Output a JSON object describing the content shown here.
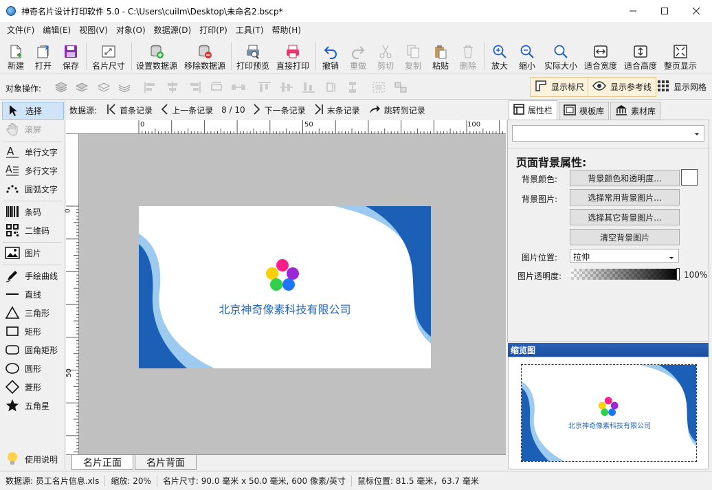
{
  "window": {
    "title": "神奇名片设计打印软件 5.0 - C:\\Users\\cuilm\\Desktop\\未命名2.bscp*"
  },
  "menu": [
    "文件(F)",
    "编辑(E)",
    "视图(V)",
    "对象(O)",
    "数据源(D)",
    "打印(P)",
    "工具(T)",
    "帮助(H)"
  ],
  "toolbar": {
    "new": "新建",
    "open": "打开",
    "save": "保存",
    "card_size": "名片尺寸",
    "set_datasource": "设置数据源",
    "remove_datasource": "移除数据源",
    "print_preview": "打印预览",
    "direct_print": "直接打印",
    "undo": "撤销",
    "redo": "重做",
    "cut": "剪切",
    "copy": "复制",
    "paste": "粘贴",
    "delete": "删除",
    "zoom_in": "放大",
    "zoom_out": "缩小",
    "actual_size": "实际大小",
    "fit_width": "适合宽度",
    "fit_height": "适合高度",
    "full_page": "整页显示"
  },
  "objbar": {
    "label": "对象操作:",
    "show_ruler": "显示标尺",
    "show_guides": "显示参考线",
    "show_grid": "显示网格"
  },
  "tools": {
    "select": "选择",
    "scroll": "滚屏",
    "single_text": "单行文字",
    "multi_text": "多行文字",
    "arc_text": "圆弧文字",
    "barcode": "条码",
    "qrcode": "二维码",
    "image": "图片",
    "freehand": "手绘曲线",
    "line": "直线",
    "triangle": "三角形",
    "rect": "矩形",
    "round_rect": "圆角矩形",
    "ellipse": "圆形",
    "diamond": "菱形",
    "star": "五角星",
    "help": "使用说明"
  },
  "nav": {
    "label": "数据源:",
    "first": "首条记录",
    "prev": "上一条记录",
    "counter": "8 / 10",
    "next": "下一条记录",
    "last": "末条记录",
    "jump": "跳转到记录"
  },
  "ruler": {
    "h_labels": [
      "0",
      "50",
      "100"
    ],
    "v_labels": [
      "0",
      "50"
    ]
  },
  "card": {
    "company": "北京神奇像素科技有限公司",
    "dot_colors": [
      "#ff1e8c",
      "#9c27d9",
      "#ffd000",
      "#2fd04a",
      "#1e74ff"
    ],
    "wave_dark": "#1b5fb7",
    "wave_light": "#9dcbf0"
  },
  "pages": {
    "front": "名片正面",
    "back": "名片背面"
  },
  "right_tabs": {
    "props": "属性栏",
    "templates": "模板库",
    "materials": "素材库"
  },
  "props": {
    "section_title": "页面背景属性:",
    "bg_color_label": "背景颜色:",
    "bg_color_btn": "背景颜色和透明度...",
    "bg_image_label": "背景图片:",
    "choose_common": "选择常用背景图片...",
    "choose_other": "选择其它背景图片...",
    "clear_bg": "清空背景图片",
    "image_pos_label": "图片位置:",
    "image_pos_value": "拉伸",
    "opacity_label": "图片透明度:",
    "opacity_value": "100%"
  },
  "thumbnail": {
    "title": "缩览图"
  },
  "status": {
    "datasource": "数据源: 员工名片信息.xls",
    "zoom": "缩放: 20%",
    "card_size": "名片尺寸: 90.0 毫米 x 50.0 毫米, 600 像素/英寸",
    "mouse_pos": "鼠标位置: 81.5 毫米，63.7 毫米"
  }
}
